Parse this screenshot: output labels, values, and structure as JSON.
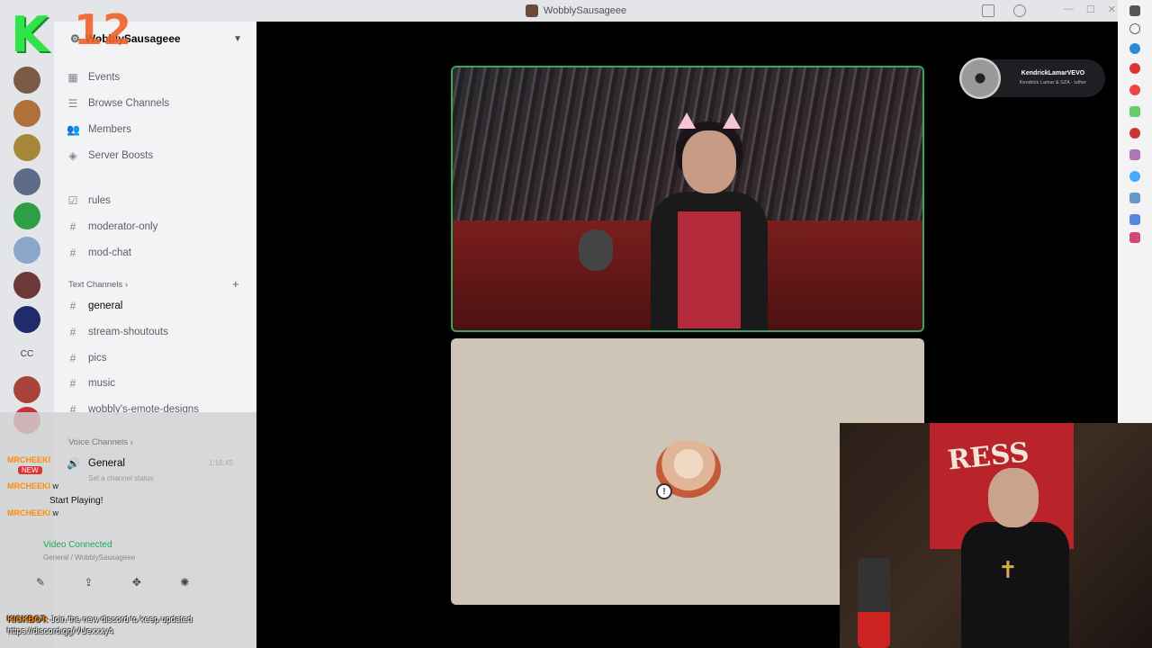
{
  "window": {
    "title": "WobblySausageee"
  },
  "overlay_logo": {
    "letter": "K",
    "number": "12"
  },
  "server": {
    "name": "WobblySausageee"
  },
  "sidebar": {
    "top_items": [
      {
        "label": "Events",
        "icon": "calendar-icon"
      },
      {
        "label": "Browse Channels",
        "icon": "browse-icon"
      },
      {
        "label": "Members",
        "icon": "members-icon"
      },
      {
        "label": "Server Boosts",
        "icon": "boost-icon"
      }
    ],
    "info_channels": [
      {
        "label": "rules",
        "icon": "checkbox-icon"
      },
      {
        "label": "moderator-only",
        "icon": "hash-icon"
      },
      {
        "label": "mod-chat",
        "icon": "hash-icon"
      }
    ],
    "text_category": "Text Channels",
    "text_channels": [
      {
        "label": "general",
        "active": true
      },
      {
        "label": "stream-shoutouts"
      },
      {
        "label": "pics"
      },
      {
        "label": "music"
      },
      {
        "label": "wobbly's-emote-designs"
      }
    ],
    "voice_category": "Voice Channels",
    "voice_channels": [
      {
        "label": "General",
        "time": "1:16:45"
      }
    ],
    "voice_status_hint": "Set a channel status"
  },
  "guilds": {
    "cc_label": "CC"
  },
  "chat_overlay": {
    "lines": [
      {
        "user": "MRCHEEKI",
        "text": "",
        "badge": "NEW"
      },
      {
        "user": "MRCHEEKI",
        "text": "w"
      },
      {
        "user": "MRCHEEKI",
        "text": "w"
      }
    ],
    "start_playing": "Start Playing!",
    "voice_connected": "Video Connected",
    "voice_location": "General / WobblySausageee",
    "banner_bot": "KICKBOT:",
    "banner_text": "Join the new discord to keep updated",
    "banner_link": "https://discord.gg/VUexxxy4"
  },
  "now_playing": {
    "artist": "KendrickLamarVEVO",
    "track": "Kendrick Lamar & SZA - luther"
  },
  "webcam_poster": {
    "text": "RESS"
  },
  "accent_colors": {
    "speaking_border": "#3ba55c",
    "brand_green": "#31e34b",
    "brand_orange": "#f0632a"
  }
}
